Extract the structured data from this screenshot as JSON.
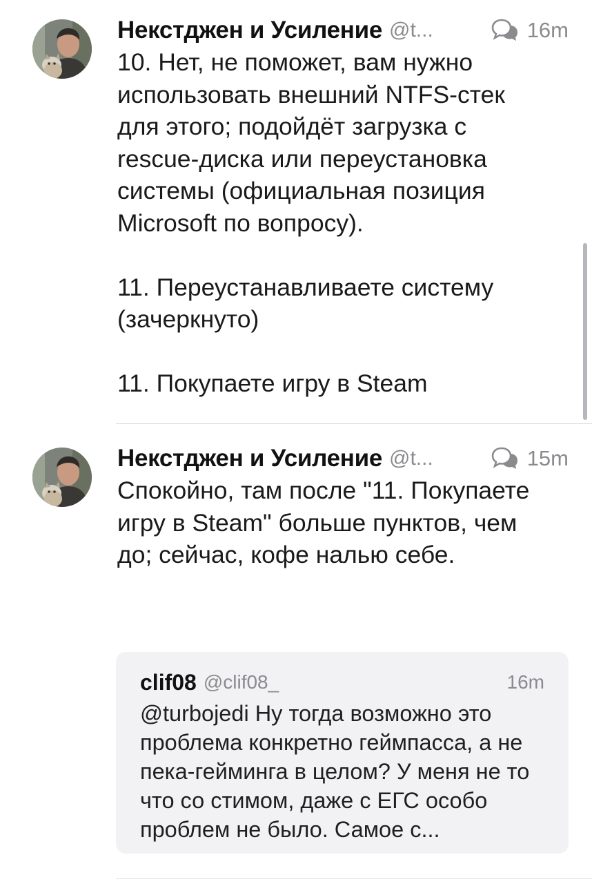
{
  "tweets": [
    {
      "author_name": "Некстджен и Усиление",
      "author_handle": "@t...",
      "time": "16m",
      "avatar_icon": "user-photo-with-cat",
      "reply_icon": "conversation-bubbles-icon",
      "text": "10. Нет, не поможет, вам нужно использовать внешний NTFS-стек для этого; подойдёт загрузка с rescue-диска или переустановка системы (официальная позиция Microsoft по вопросу).\n\n11. Переустанавливаете систему (зачеркнуто)\n\n11. Покупаете игру в Steam"
    },
    {
      "author_name": "Некстджен и Усиление",
      "author_handle": "@t...",
      "time": "15m",
      "avatar_icon": "user-photo-with-cat",
      "reply_icon": "conversation-bubbles-icon",
      "text": "Спокойно, там после \"11. Покупаете игру в Steam\" больше пунктов, чем до; сейчас, кофе налью себе.",
      "quoted": {
        "author_name": "clif08",
        "author_handle": "@clif08_",
        "time": "16m",
        "text": "@turbojedi Ну тогда возможно это проблема конкретно геймпасса, а не пека-гейминга в целом? У меня не то что со стимом, даже с ЕГС особо проблем не было. Самое с..."
      }
    }
  ],
  "colors": {
    "text": "#1a1a1a",
    "secondary": "#8b8b8f",
    "divider": "#dcdcdf",
    "quote_background": "#f2f2f4"
  }
}
